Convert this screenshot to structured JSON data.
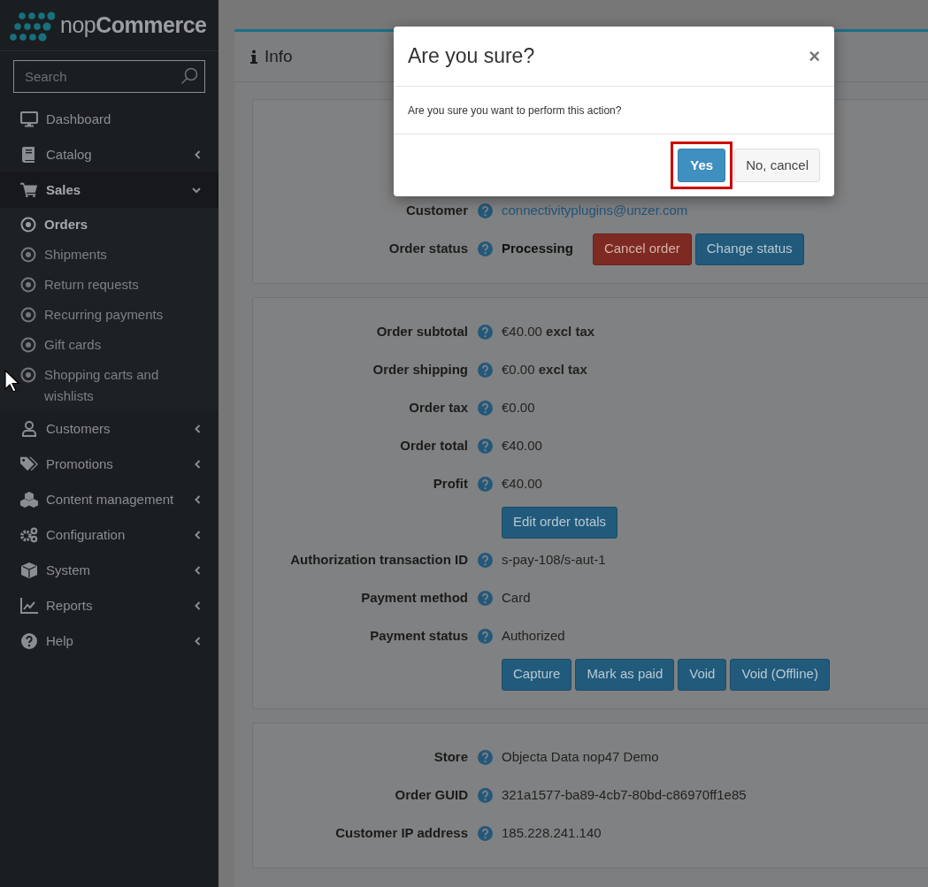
{
  "sidebar": {
    "logo": "nop**Commerce**",
    "search": {
      "placeholder": "Search"
    },
    "items": [
      {
        "label": "Dashboard",
        "kind": "link"
      },
      {
        "label": "Catalog",
        "kind": "menu",
        "expanded": false
      },
      {
        "label": "Sales",
        "kind": "menu",
        "expanded": true,
        "children": [
          {
            "label": "Orders",
            "selected": true
          },
          {
            "label": "Shipments",
            "selected": false
          },
          {
            "label": "Return requests",
            "selected": false
          },
          {
            "label": "Recurring payments",
            "selected": false
          },
          {
            "label": "Gift cards",
            "selected": false
          },
          {
            "label": "Shopping carts and wishlists",
            "selected": false
          }
        ]
      },
      {
        "label": "Customers",
        "kind": "menu",
        "expanded": false
      },
      {
        "label": "Promotions",
        "kind": "menu",
        "expanded": false
      },
      {
        "label": "Content management",
        "kind": "menu",
        "expanded": false
      },
      {
        "label": "Configuration",
        "kind": "menu",
        "expanded": false
      },
      {
        "label": "System",
        "kind": "menu",
        "expanded": false
      },
      {
        "label": "Reports",
        "kind": "menu",
        "expanded": false
      },
      {
        "label": "Help",
        "kind": "menu",
        "expanded": false
      }
    ]
  },
  "panel": {
    "title": "Info",
    "cards": [
      {
        "rows": [
          {
            "label": "Customer",
            "value": "connectivityplugins@unzer.com",
            "kind": "link"
          },
          {
            "label": "Order status",
            "value": "Processing",
            "kind": "status",
            "buttons": [
              {
                "label": "Cancel order",
                "kind": "danger"
              },
              {
                "label": "Change status",
                "kind": "primary"
              }
            ]
          }
        ]
      },
      {
        "rows": [
          {
            "label": "Order subtotal",
            "value": "€40.00 **excl tax**",
            "kind": "text"
          },
          {
            "label": "Order shipping",
            "value": "€0.00 **excl tax**",
            "kind": "text"
          },
          {
            "label": "Order tax",
            "value": "€0.00",
            "kind": "text"
          },
          {
            "label": "Order total",
            "value": "€40.00",
            "kind": "text"
          },
          {
            "label": "Profit",
            "value": "€40.00",
            "kind": "text"
          },
          {
            "buttons": [
              {
                "label": "Edit order totals",
                "kind": "primary"
              }
            ]
          },
          {
            "label": "Authorization transaction ID",
            "value": "s-pay-108/s-aut-1",
            "kind": "text"
          },
          {
            "label": "Payment method",
            "value": "Card",
            "kind": "text"
          },
          {
            "label": "Payment status",
            "value": "Authorized",
            "kind": "text"
          },
          {
            "buttons": [
              {
                "label": "Capture",
                "kind": "primary"
              },
              {
                "label": "Mark as paid",
                "kind": "primary"
              },
              {
                "label": "Void",
                "kind": "primary"
              },
              {
                "label": "Void (Offline)",
                "kind": "primary"
              }
            ]
          }
        ]
      },
      {
        "rows": [
          {
            "label": "Store",
            "value": "Objecta Data nop47 Demo",
            "kind": "text"
          },
          {
            "label": "Order GUID",
            "value": "321a1577-ba89-4cb7-80bd-c86970ff1e85",
            "kind": "text"
          },
          {
            "label": "Customer IP address",
            "value": "185.228.241.140",
            "kind": "text"
          }
        ]
      }
    ]
  },
  "dialog": {
    "title": "Are you sure?",
    "close": "×",
    "message": "Are you sure you want to perform this action?",
    "buttons": [
      {
        "label": "Yes",
        "kind": "primary",
        "highlighted": true
      },
      {
        "label": "No, cancel",
        "kind": "secondary",
        "highlighted": false
      }
    ]
  }
}
